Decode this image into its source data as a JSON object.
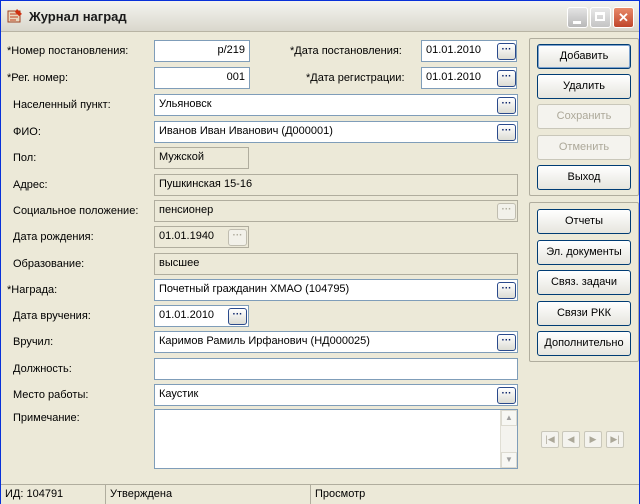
{
  "window": {
    "title": "Журнал наград"
  },
  "form": {
    "resolution_number": {
      "label": "*Номер постановления:",
      "value": "р/219"
    },
    "resolution_date": {
      "label": "*Дата постановления:",
      "value": "01.01.2010"
    },
    "reg_number": {
      "label": "*Рег. номер:",
      "value": "001"
    },
    "reg_date": {
      "label": "*Дата регистрации:",
      "value": "01.01.2010"
    },
    "locality": {
      "label": "Населенный пункт:",
      "value": "Ульяновск"
    },
    "fio": {
      "label": "ФИО:",
      "value": "Иванов Иван Иванович (Д000001)"
    },
    "gender": {
      "label": "Пол:",
      "value": "Мужской"
    },
    "address": {
      "label": "Адрес:",
      "value": "Пушкинская 15-16"
    },
    "social_status": {
      "label": "Социальное положение:",
      "value": "пенсионер"
    },
    "birth_date": {
      "label": "Дата рождения:",
      "value": "01.01.1940"
    },
    "education": {
      "label": "Образование:",
      "value": "высшее"
    },
    "award": {
      "label": "*Награда:",
      "value": "Почетный гражданин ХМАО (104795)"
    },
    "award_date": {
      "label": "Дата вручения:",
      "value": "01.01.2010"
    },
    "presented_by": {
      "label": "Вручил:",
      "value": "Каримов Рамиль Ирфанович (НД000025)"
    },
    "position": {
      "label": "Должность:",
      "value": ""
    },
    "workplace": {
      "label": "Место работы:",
      "value": "Каустик"
    },
    "note": {
      "label": "Примечание:",
      "value": ""
    }
  },
  "actions": {
    "add": "Добавить",
    "delete": "Удалить",
    "save": "Сохранить",
    "cancel": "Отменить",
    "exit": "Выход"
  },
  "links": {
    "reports": "Отчеты",
    "el_docs": "Эл. документы",
    "linked_tasks": "Связ. задачи",
    "rkk_links": "Связи РКК",
    "additional": "Дополнительно"
  },
  "navigation": {
    "first": "|◀",
    "prev": "◀",
    "next": "▶",
    "last": "▶|"
  },
  "ellipsis": "···",
  "status": {
    "id": "ИД: 104791",
    "state": "Утверждена",
    "mode": "Просмотр"
  }
}
